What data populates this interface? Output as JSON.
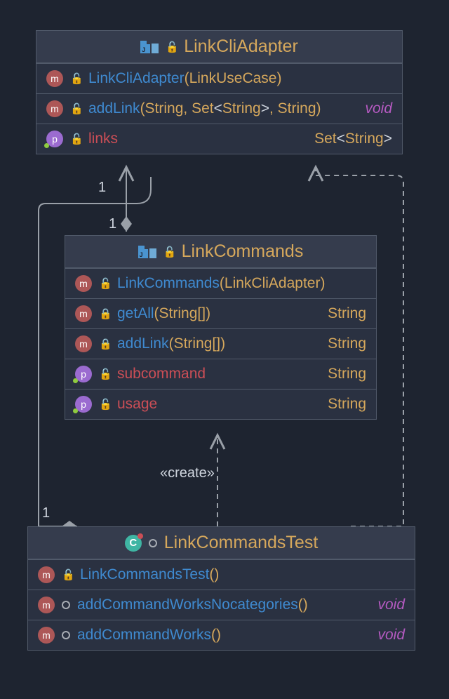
{
  "class1": {
    "title": "LinkCliAdapter",
    "methods": [
      {
        "name": "LinkCliAdapter",
        "params": "LinkUseCase",
        "ret": null,
        "vis": "public"
      },
      {
        "name": "addLink",
        "params": "String, Set<String>, String",
        "ret": "void",
        "vis": "public"
      }
    ],
    "props": [
      {
        "name": "links",
        "type": "Set<String>",
        "vis": "public"
      }
    ]
  },
  "class2": {
    "title": "LinkCommands",
    "methods": [
      {
        "name": "LinkCommands",
        "params": "LinkCliAdapter",
        "ret": null,
        "vis": "public"
      },
      {
        "name": "getAll",
        "params": "String[]",
        "ret": "String",
        "vis": "private"
      },
      {
        "name": "addLink",
        "params": "String[]",
        "ret": "String",
        "vis": "private"
      }
    ],
    "props": [
      {
        "name": "subcommand",
        "type": "String",
        "vis": "public"
      },
      {
        "name": "usage",
        "type": "String",
        "vis": "public"
      }
    ]
  },
  "class3": {
    "title": "LinkCommandsTest",
    "methods": [
      {
        "name": "LinkCommandsTest",
        "params": "",
        "ret": null,
        "vis": "public"
      },
      {
        "name": "addCommandWorksNocategories",
        "params": "",
        "ret": "void",
        "vis": "package"
      },
      {
        "name": "addCommandWorks",
        "params": "",
        "ret": "void",
        "vis": "package"
      }
    ]
  },
  "relations": {
    "mult1": "1",
    "mult2": "1",
    "mult3": "1",
    "create": "«create»"
  }
}
